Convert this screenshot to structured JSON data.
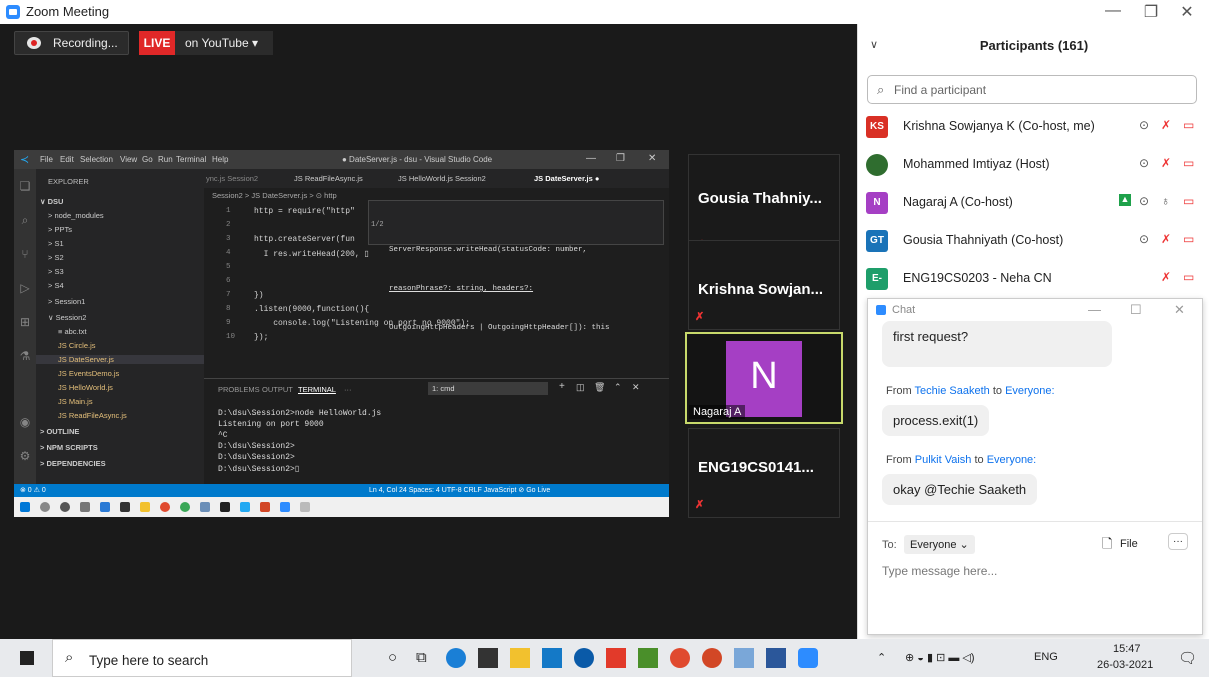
{
  "window": {
    "title": "Zoom Meeting",
    "minimize": "—",
    "restore": "❐",
    "close": "✕"
  },
  "toolbar": {
    "recording": "Recording...",
    "live": "LIVE",
    "youtube": "on YouTube ▾"
  },
  "vscode": {
    "menu": [
      "File",
      "Edit",
      "Selection",
      "View",
      "Go",
      "Run",
      "Terminal",
      "Help"
    ],
    "title": "● DateServer.js - dsu - Visual Studio Code",
    "explorer": "EXPLORER",
    "tree": [
      "∨ DSU",
      "> node_modules",
      "> PPTs",
      "> S1",
      "> S2",
      "> S3",
      "> S4",
      "> Session1",
      "∨ Session2",
      "≡ abc.txt",
      "JS Circle.js",
      "JS DateServer.js",
      "JS EventsDemo.js",
      "JS HelloWorld.js",
      "JS Main.js",
      "JS ReadFileAsync.js",
      "> OUTLINE",
      "> NPM SCRIPTS",
      "> DEPENDENCIES"
    ],
    "tabs": [
      "ync.js Session2",
      "JS ReadFileAsync.js",
      "JS HelloWorld.js Session2",
      "JS DateServer.js ●"
    ],
    "breadcrumb": "Session2 > JS DateServer.js > ⊙ http",
    "lines": [
      "1",
      "2",
      "3",
      "4",
      "5",
      "6",
      "7",
      "8",
      "9",
      "10"
    ],
    "code": [
      "http = require(\"http\"",
      "",
      "http.createServer(fun",
      "  I res.writeHead(200, ▯",
      "",
      "",
      "})",
      ".listen(9000,function(){",
      "    console.log(\"Listening on port no 9000\");",
      "});"
    ],
    "hover": [
      "ServerResponse.writeHead(statusCode: number,",
      "reasonPhrase?: string, headers?:",
      "OutgoingHttpHeaders | OutgoingHttpHeader[]): this"
    ],
    "hover_page": "1/2",
    "panel_tabs": [
      "PROBLEMS",
      "OUTPUT",
      "TERMINAL",
      "···"
    ],
    "terminal_select": "1: cmd",
    "terminal": [
      "D:\\dsu\\Session2>node HelloWorld.js",
      "Listening on port 9000",
      "^C",
      "D:\\dsu\\Session2>",
      "D:\\dsu\\Session2>",
      "D:\\dsu\\Session2>▯"
    ],
    "status_left": "⊗ 0 ⚠ 0",
    "status_right": "Ln 4, Col 24   Spaces: 4   UTF-8   CRLF   JavaScript   ⊘ Go Live"
  },
  "tiles": [
    {
      "name": "Gousia Thahniy..."
    },
    {
      "name": "Krishna Sowjan..."
    },
    {
      "name": "ENG19CS0141..."
    }
  ],
  "highlight_tile": {
    "initial": "N",
    "name": "Nagaraj A"
  },
  "participants": {
    "header": "Participants (161)",
    "search_placeholder": "Find a participant",
    "items": [
      {
        "initials": "KS",
        "name": "Krishna Sowjanya K (Co-host, me)",
        "color": "#d93025"
      },
      {
        "initials": "",
        "name": "Mohammed Imtiyaz (Host)",
        "color": "#2f6d2f"
      },
      {
        "initials": "N",
        "name": "Nagaraj A (Co-host)",
        "color": "#a53fc4"
      },
      {
        "initials": "GT",
        "name": "Gousia Thahniyath (Co-host)",
        "color": "#1a73b8"
      },
      {
        "initials": "E-",
        "name": "ENG19CS0203 - Neha CN",
        "color": "#1e9e6a"
      }
    ]
  },
  "chat": {
    "title": "Chat",
    "messages": [
      {
        "text": "first request?"
      },
      {
        "from": "From",
        "sender": "Techie Saaketh",
        "to": "to",
        "recipient": "Everyone:",
        "text": "process.exit(1)"
      },
      {
        "from": "From",
        "sender": "Pulkit Vaish",
        "to": "to",
        "recipient": "Everyone:",
        "text": "okay @Techie Saaketh"
      }
    ],
    "to_label": "To:",
    "to_value": "Everyone ⌄",
    "file_label": "File",
    "more": "···",
    "input_placeholder": "Type message here..."
  },
  "taskbar": {
    "search": "Type here to search",
    "lang": "ENG",
    "time": "15:47",
    "date": "26-03-2021"
  }
}
